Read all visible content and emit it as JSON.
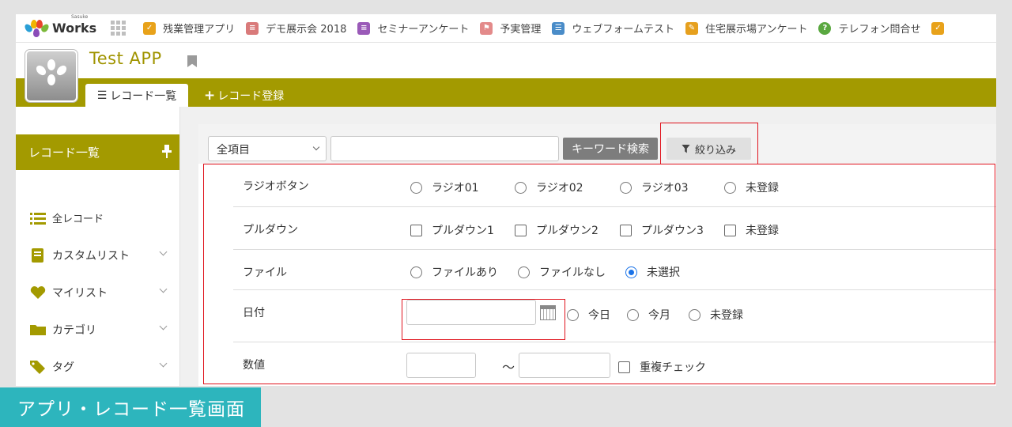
{
  "topbar": {
    "logo_sub": "Sasuke",
    "logo_text": "Works",
    "apps": [
      {
        "label": "残業管理アプリ",
        "icon": "checkbox-icon",
        "color": "#e8a21a"
      },
      {
        "label": "デモ展示会 2018",
        "icon": "document-icon",
        "color": "#d97a7a"
      },
      {
        "label": "セミナーアンケート",
        "icon": "document-icon",
        "color": "#9a5ab8"
      },
      {
        "label": "予実管理",
        "icon": "flag-icon",
        "color": "#e38a8a"
      },
      {
        "label": "ウェブフォームテスト",
        "icon": "list-icon",
        "color": "#4a8cc8"
      },
      {
        "label": "住宅展示場アンケート",
        "icon": "memo-icon",
        "color": "#e6a01e"
      },
      {
        "label": "テレフォン問合せ",
        "icon": "question-icon",
        "color": "#5aa840"
      }
    ]
  },
  "app": {
    "title": "Test APP",
    "tabs": {
      "list": "レコード一覧",
      "register": "レコード登録"
    }
  },
  "sidebar": {
    "header": "レコード一覧",
    "items": [
      {
        "label": "全レコード",
        "icon": "list-icon"
      },
      {
        "label": "カスタムリスト",
        "icon": "book-icon"
      },
      {
        "label": "マイリスト",
        "icon": "heart-icon"
      },
      {
        "label": "カテゴリ",
        "icon": "folder-icon"
      },
      {
        "label": "タグ",
        "icon": "tag-icon"
      }
    ]
  },
  "search": {
    "field_select": "全項目",
    "keyword_value": "",
    "keyword_button": "キーワード検索",
    "filter_button": "絞り込み"
  },
  "filters": {
    "radio": {
      "label": "ラジオボタン",
      "options": [
        "ラジオ01",
        "ラジオ02",
        "ラジオ03",
        "未登録"
      ]
    },
    "pulldown": {
      "label": "プルダウン",
      "options": [
        "プルダウン1",
        "プルダウン2",
        "プルダウン3",
        "未登録"
      ]
    },
    "file": {
      "label": "ファイル",
      "options": [
        "ファイルあり",
        "ファイルなし",
        "未選択"
      ],
      "selected": "未選択"
    },
    "date": {
      "label": "日付",
      "value": "",
      "options": [
        "今日",
        "今月",
        "未登録"
      ]
    },
    "number": {
      "label": "数値",
      "tilde": "〜",
      "duplicate_check": "重複チェック"
    }
  },
  "caption": "アプリ・レコード一覧画面",
  "colors": {
    "accent": "#a39a00",
    "title": "#a09400",
    "highlight": "#e0141e",
    "caption_bg": "#2db5bd",
    "radio_selected": "#1a73e8"
  }
}
